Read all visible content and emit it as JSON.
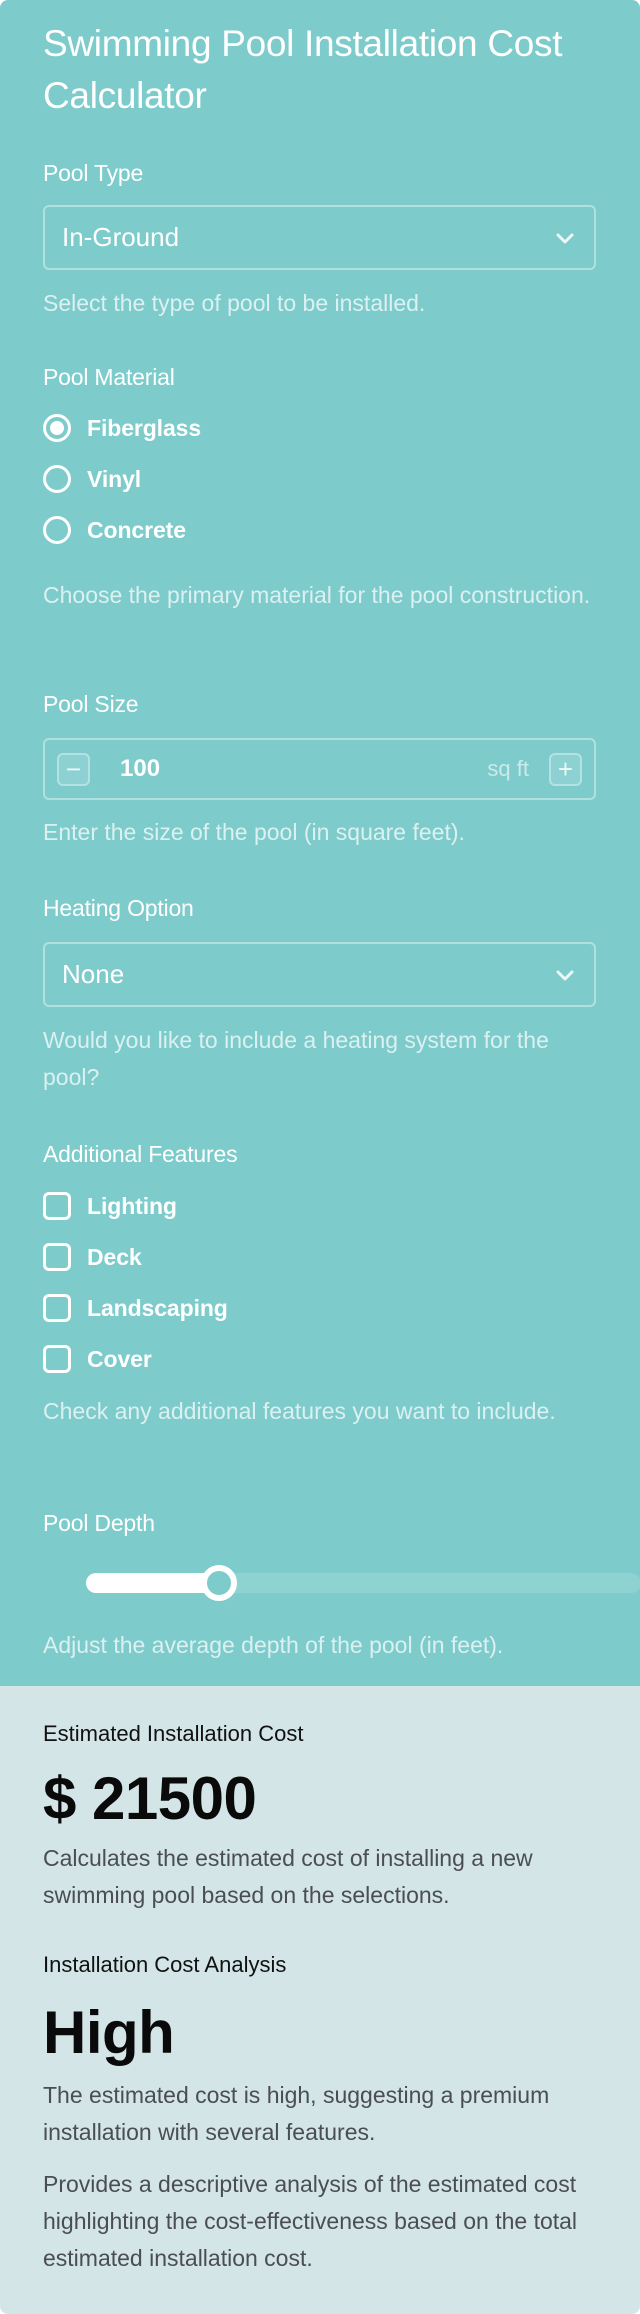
{
  "title": "Swimming Pool Installation Cost Calculator",
  "colors": {
    "form_background": "#7ECBCC",
    "results_background": "#D3E5E7",
    "accent": "#FFFFFF"
  },
  "pool_type": {
    "label": "Pool Type",
    "selected": "In-Ground",
    "help": "Select the type of pool to be installed.",
    "icon": "chevron-down-icon"
  },
  "pool_material": {
    "label": "Pool Material",
    "options": [
      {
        "label": "Fiberglass",
        "selected": true
      },
      {
        "label": "Vinyl",
        "selected": false
      },
      {
        "label": "Concrete",
        "selected": false
      }
    ],
    "help": "Choose the primary material for the pool construction."
  },
  "pool_size": {
    "label": "Pool Size",
    "value": "100",
    "unit": "sq ft",
    "decrement_icon": "−",
    "increment_icon": "+",
    "help": "Enter the size of the pool (in square feet)."
  },
  "heating": {
    "label": "Heating Option",
    "selected": "None",
    "help": "Would you like to include a heating system for the pool?",
    "icon": "chevron-down-icon"
  },
  "features": {
    "label": "Additional Features",
    "options": [
      {
        "label": "Lighting",
        "checked": false
      },
      {
        "label": "Deck",
        "checked": false
      },
      {
        "label": "Landscaping",
        "checked": false
      },
      {
        "label": "Cover",
        "checked": false
      }
    ],
    "help": "Check any additional features you want to include."
  },
  "pool_depth": {
    "label": "Pool Depth",
    "fraction": 0.24,
    "help": "Adjust the average depth of the pool (in feet)."
  },
  "results": {
    "cost": {
      "label": "Estimated Installation Cost",
      "value": "$ 21500",
      "description": "Calculates the estimated cost of installing a new swimming pool based on the selections."
    },
    "analysis": {
      "label": "Installation Cost Analysis",
      "value": "High",
      "detail": "The estimated cost is high, suggesting a premium installation with several features.",
      "description": "Provides a descriptive analysis of the estimated cost highlighting the cost-effectiveness based on the total estimated installation cost."
    }
  }
}
